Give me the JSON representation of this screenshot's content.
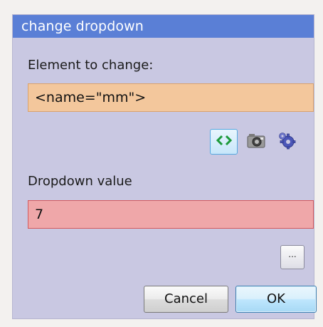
{
  "dialog": {
    "title": "change dropdown",
    "element_label": "Element to change:",
    "element_value": "<name=\"mm\">",
    "dropdown_label": "Dropdown value",
    "dropdown_value": "7",
    "ellipsis_label": "...",
    "cancel_label": "Cancel",
    "ok_label": "OK"
  },
  "toolbar": {
    "icons": [
      "code-tag-icon",
      "camera-icon",
      "gear-icon"
    ]
  },
  "colors": {
    "title_bar": "#5a7fd6",
    "dialog_bg": "#c9c8e2",
    "element_field_bg": "#f3c79c",
    "value_field_bg": "#efa7a9",
    "value_field_border": "#d25a5e"
  }
}
